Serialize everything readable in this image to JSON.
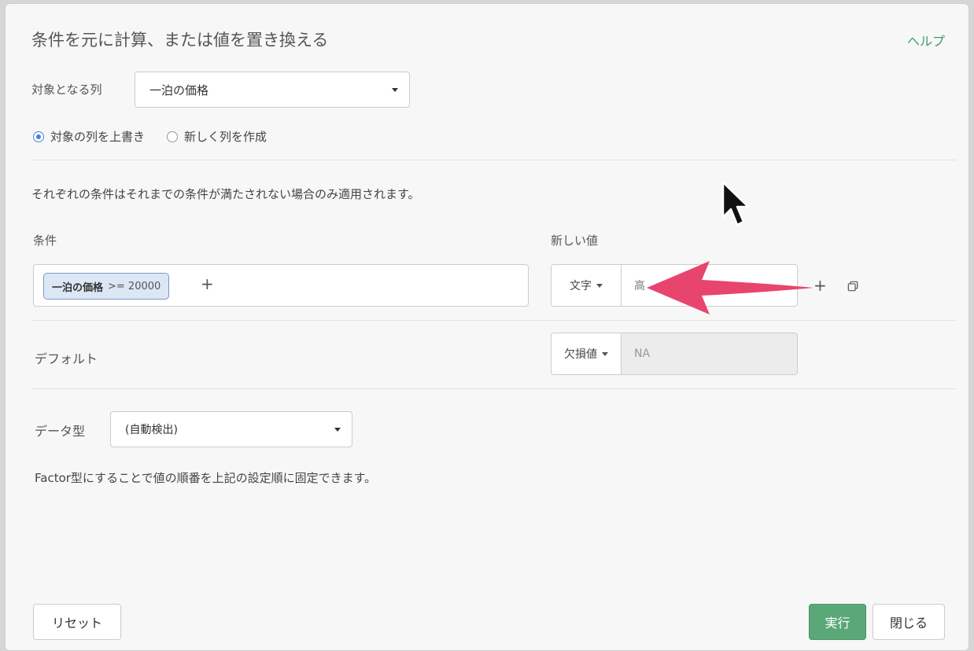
{
  "dialog": {
    "title": "条件を元に計算、または値を置き換える",
    "help": "ヘルプ"
  },
  "target": {
    "label": "対象となる列",
    "selected": "一泊の価格"
  },
  "mode": {
    "overwrite": "対象の列を上書き",
    "create": "新しく列を作成",
    "selected": "overwrite"
  },
  "note_conditions": "それぞれの条件はそれまでの条件が満たされない場合のみ適用されます。",
  "headers": {
    "condition": "条件",
    "new_value": "新しい値"
  },
  "condition_row": {
    "chip_column": "一泊の価格",
    "chip_expr": ">= 20000",
    "add": "+",
    "value_type": "文字",
    "value": "高",
    "add_row": "+"
  },
  "default_row": {
    "label": "デフォルト",
    "value_type": "欠損値",
    "value": "NA"
  },
  "data_type": {
    "label": "データ型",
    "selected": "(自動検出)"
  },
  "note_factor": "Factor型にすることで値の順番を上記の設定順に固定できます。",
  "buttons": {
    "reset": "リセット",
    "run": "実行",
    "close": "閉じる"
  },
  "colors": {
    "accent_green": "#5aa777",
    "arrow": "#e8456e",
    "chip_border": "#7b98c8"
  }
}
